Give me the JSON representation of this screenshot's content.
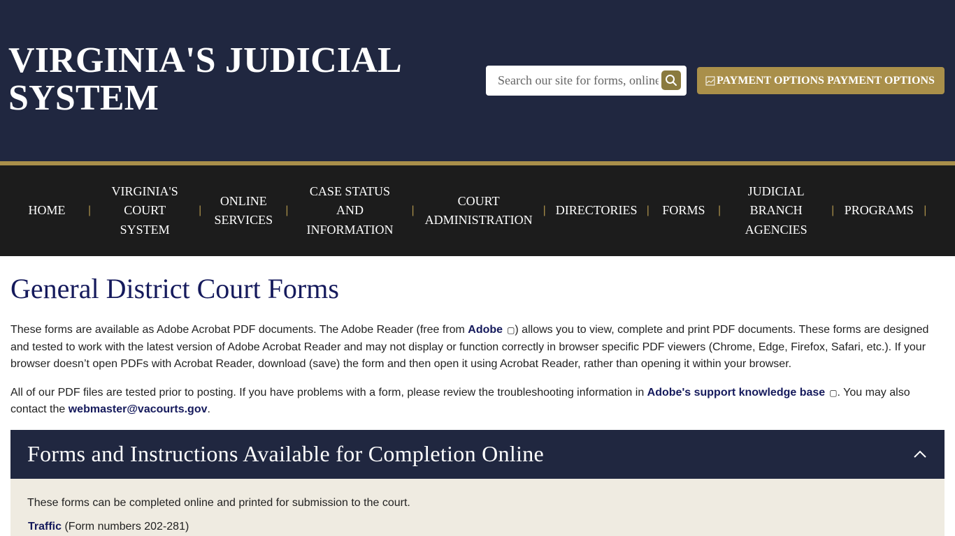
{
  "header": {
    "title": "VIRGINIA'S JUDICIAL SYSTEM",
    "search_placeholder": "Search our site for forms, online services, and more",
    "payment_button": {
      "broken_image_alt": "PAYMENT OPTIONS",
      "label": "PAYMENT OPTIONS"
    }
  },
  "nav": {
    "items": [
      {
        "label": "HOME"
      },
      {
        "label": "VIRGINIA'S COURT SYSTEM"
      },
      {
        "label": "ONLINE SERVICES"
      },
      {
        "label": "CASE STATUS AND INFORMATION"
      },
      {
        "label": "COURT ADMINISTRATION"
      },
      {
        "label": "DIRECTORIES"
      },
      {
        "label": "FORMS"
      },
      {
        "label": "JUDICIAL BRANCH AGENCIES"
      },
      {
        "label": "PROGRAMS"
      }
    ],
    "separator": "|"
  },
  "main": {
    "title": "General District Court Forms",
    "p1": {
      "t1": "These forms are available as Adobe Acrobat PDF documents. The Adobe Reader (free from ",
      "link": "Adobe",
      "t2": ") allows you to view, complete and print PDF documents. These forms are designed and tested to work with the latest version of Adobe Acrobat Reader and may not display or function correctly in browser specific PDF viewers (Chrome, Edge, Firefox, Safari, etc.).  If your browser doesn’t open PDFs with Acrobat Reader, download (save) the form and then open it using Acrobat Reader, rather than opening it within your browser."
    },
    "p2": {
      "t1": "All of our PDF files are tested prior to posting. If you have problems with a form, please review the troubleshooting information in ",
      "link": "Adobe's support knowledge base",
      "t2": ". You may also contact the ",
      "email": "webmaster@vacourts.gov",
      "t3": "."
    },
    "accordion": {
      "title": "Forms and Instructions Available for Completion Online",
      "body_text": "These forms can be completed online and printed for submission to the court.",
      "link_label": "Traffic",
      "link_suffix": " (Form numbers 202-281)"
    }
  },
  "icons": {
    "external_link": "external-link-icon",
    "search": "search-icon",
    "chevron": "chevron-up-icon"
  },
  "colors": {
    "header_bg": "#202740",
    "accent_gold": "#a98f4a",
    "nav_bg": "#1c1c1c",
    "title_navy": "#151a5c",
    "panel_beige": "#efebe1"
  }
}
